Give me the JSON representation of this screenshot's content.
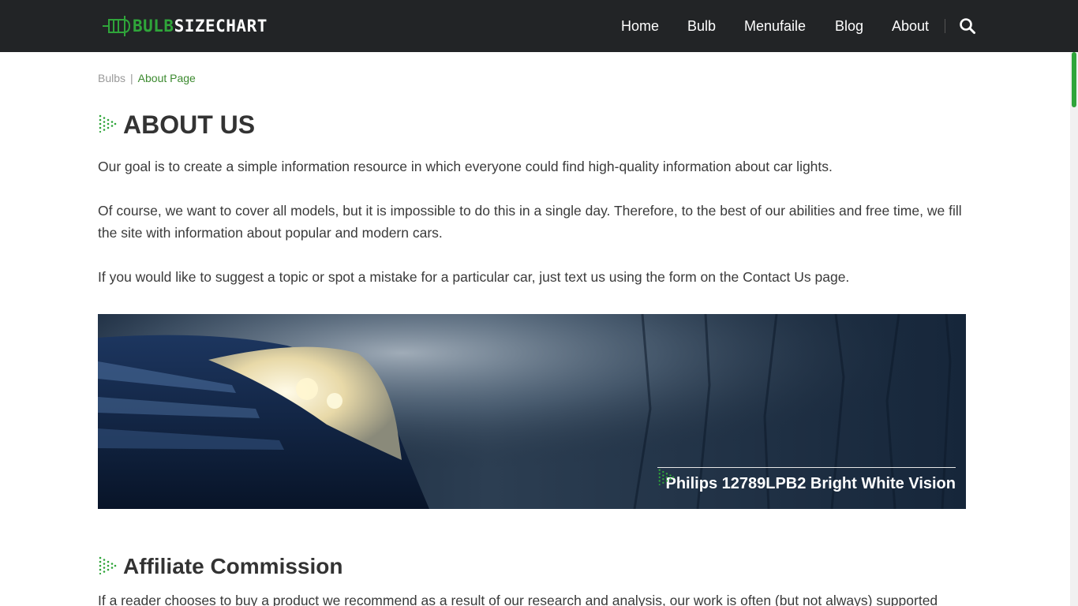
{
  "header": {
    "logo": {
      "part1": "BULB",
      "part2": "SIZECHART"
    },
    "nav": [
      {
        "label": "Home"
      },
      {
        "label": "Bulb"
      },
      {
        "label": "Menufaile"
      },
      {
        "label": "Blog"
      },
      {
        "label": "About"
      }
    ],
    "search_icon": "search-icon"
  },
  "breadcrumb": {
    "home": "Bulbs",
    "separator": "|",
    "current": "About Page"
  },
  "main": {
    "title": "ABOUT US",
    "paragraphs": [
      "Our goal is to create a simple information resource in which everyone could find high-quality information about car lights.",
      "Of course, we want to cover all models, but it is impossible to do this in a single day. Therefore, to the best of our abilities and free time, we fill the site with information about popular and modern cars.",
      "If you would like to suggest a topic or spot a mistake for a particular car, just text us using the form on the Contact Us page."
    ],
    "hero": {
      "caption": "Philips 12789LPB2 Bright White Vision"
    },
    "section2": {
      "title": "Affiliate Commission",
      "text": "If a reader chooses to buy a product we recommend as a result of our research and analysis, our work is often (but not always) supported"
    }
  },
  "colors": {
    "header_bg": "#222426",
    "accent": "#2fa53a",
    "breadcrumb_current": "#3c8a2f",
    "text": "#3a3a3a"
  }
}
